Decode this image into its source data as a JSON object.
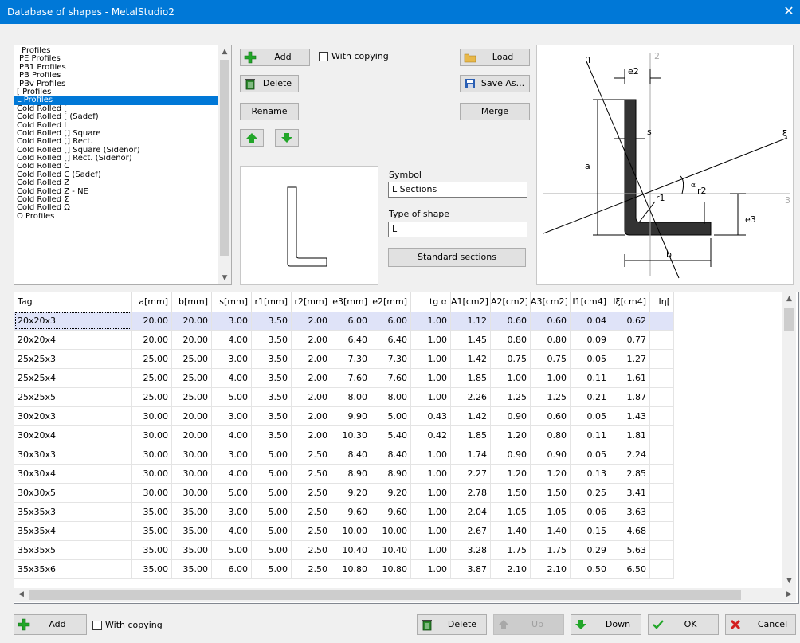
{
  "window": {
    "title": "Database of shapes - MetalStudio2",
    "close": "✕"
  },
  "profile_list": {
    "items": [
      "I Profiles",
      "IPE Profiles",
      "IPB1 Profiles",
      "IPB Profiles",
      "IPBv Profiles",
      "[ Profiles",
      "L Profiles",
      "Cold Rolled [",
      "Cold Rolled [ (Sadef)",
      "Cold Rolled L",
      "Cold Rolled [] Square",
      "Cold Rolled [] Rect.",
      "Cold Rolled [] Square (Sidenor)",
      "Cold Rolled [] Rect. (Sidenor)",
      "Cold Rolled C",
      "Cold Rolled C (Sadef)",
      "Cold Rolled Z",
      "Cold Rolled Z - NE",
      "Cold Rolled Σ",
      "Cold Rolled Ω",
      "O Profiles"
    ],
    "selected": "L Profiles"
  },
  "top_buttons": {
    "add": "Add",
    "with_copying": "With copying",
    "delete": "Delete",
    "rename": "Rename",
    "load": "Load",
    "save_as": "Save As...",
    "merge": "Merge"
  },
  "symbol": {
    "label": "Symbol",
    "value": "L Sections"
  },
  "shape_type": {
    "label": "Type of shape",
    "value": "L"
  },
  "standard_sections": "Standard sections",
  "diagram": {
    "labels": [
      "η",
      "2",
      "e2",
      "ξ",
      "s",
      "a",
      "α",
      "r2",
      "r1",
      "e3",
      "3",
      "b"
    ]
  },
  "table": {
    "columns": [
      "Tag",
      "a[mm]",
      "b[mm]",
      "s[mm]",
      "r1[mm]",
      "r2[mm]",
      "e3[mm]",
      "e2[mm]",
      "tg α",
      "A1[cm2]",
      "A2[cm2]",
      "A3[cm2]",
      "I1[cm4]",
      "Iξ[cm4]",
      "Iη["
    ],
    "rows": [
      [
        "20x20x3",
        "20.00",
        "20.00",
        "3.00",
        "3.50",
        "2.00",
        "6.00",
        "6.00",
        "1.00",
        "1.12",
        "0.60",
        "0.60",
        "0.04",
        "0.62",
        ""
      ],
      [
        "20x20x4",
        "20.00",
        "20.00",
        "4.00",
        "3.50",
        "2.00",
        "6.40",
        "6.40",
        "1.00",
        "1.45",
        "0.80",
        "0.80",
        "0.09",
        "0.77",
        ""
      ],
      [
        "25x25x3",
        "25.00",
        "25.00",
        "3.00",
        "3.50",
        "2.00",
        "7.30",
        "7.30",
        "1.00",
        "1.42",
        "0.75",
        "0.75",
        "0.05",
        "1.27",
        ""
      ],
      [
        "25x25x4",
        "25.00",
        "25.00",
        "4.00",
        "3.50",
        "2.00",
        "7.60",
        "7.60",
        "1.00",
        "1.85",
        "1.00",
        "1.00",
        "0.11",
        "1.61",
        ""
      ],
      [
        "25x25x5",
        "25.00",
        "25.00",
        "5.00",
        "3.50",
        "2.00",
        "8.00",
        "8.00",
        "1.00",
        "2.26",
        "1.25",
        "1.25",
        "0.21",
        "1.87",
        ""
      ],
      [
        "30x20x3",
        "30.00",
        "20.00",
        "3.00",
        "3.50",
        "2.00",
        "9.90",
        "5.00",
        "0.43",
        "1.42",
        "0.90",
        "0.60",
        "0.05",
        "1.43",
        ""
      ],
      [
        "30x20x4",
        "30.00",
        "20.00",
        "4.00",
        "3.50",
        "2.00",
        "10.30",
        "5.40",
        "0.42",
        "1.85",
        "1.20",
        "0.80",
        "0.11",
        "1.81",
        ""
      ],
      [
        "30x30x3",
        "30.00",
        "30.00",
        "3.00",
        "5.00",
        "2.50",
        "8.40",
        "8.40",
        "1.00",
        "1.74",
        "0.90",
        "0.90",
        "0.05",
        "2.24",
        ""
      ],
      [
        "30x30x4",
        "30.00",
        "30.00",
        "4.00",
        "5.00",
        "2.50",
        "8.90",
        "8.90",
        "1.00",
        "2.27",
        "1.20",
        "1.20",
        "0.13",
        "2.85",
        ""
      ],
      [
        "30x30x5",
        "30.00",
        "30.00",
        "5.00",
        "5.00",
        "2.50",
        "9.20",
        "9.20",
        "1.00",
        "2.78",
        "1.50",
        "1.50",
        "0.25",
        "3.41",
        ""
      ],
      [
        "35x35x3",
        "35.00",
        "35.00",
        "3.00",
        "5.00",
        "2.50",
        "9.60",
        "9.60",
        "1.00",
        "2.04",
        "1.05",
        "1.05",
        "0.06",
        "3.63",
        ""
      ],
      [
        "35x35x4",
        "35.00",
        "35.00",
        "4.00",
        "5.00",
        "2.50",
        "10.00",
        "10.00",
        "1.00",
        "2.67",
        "1.40",
        "1.40",
        "0.15",
        "4.68",
        ""
      ],
      [
        "35x35x5",
        "35.00",
        "35.00",
        "5.00",
        "5.00",
        "2.50",
        "10.40",
        "10.40",
        "1.00",
        "3.28",
        "1.75",
        "1.75",
        "0.29",
        "5.63",
        ""
      ],
      [
        "35x35x6",
        "35.00",
        "35.00",
        "6.00",
        "5.00",
        "2.50",
        "10.80",
        "10.80",
        "1.00",
        "3.87",
        "2.10",
        "2.10",
        "0.50",
        "6.50",
        ""
      ]
    ],
    "selected_row": 0
  },
  "bottom_buttons": {
    "add": "Add",
    "with_copying": "With copying",
    "delete": "Delete",
    "up": "Up",
    "down": "Down",
    "ok": "OK",
    "cancel": "Cancel"
  },
  "colors": {
    "titlebar": "#0078d7",
    "selection": "#0078d7",
    "row_selection": "#dfe3f8",
    "green": "#22a629",
    "red": "#d32020"
  }
}
